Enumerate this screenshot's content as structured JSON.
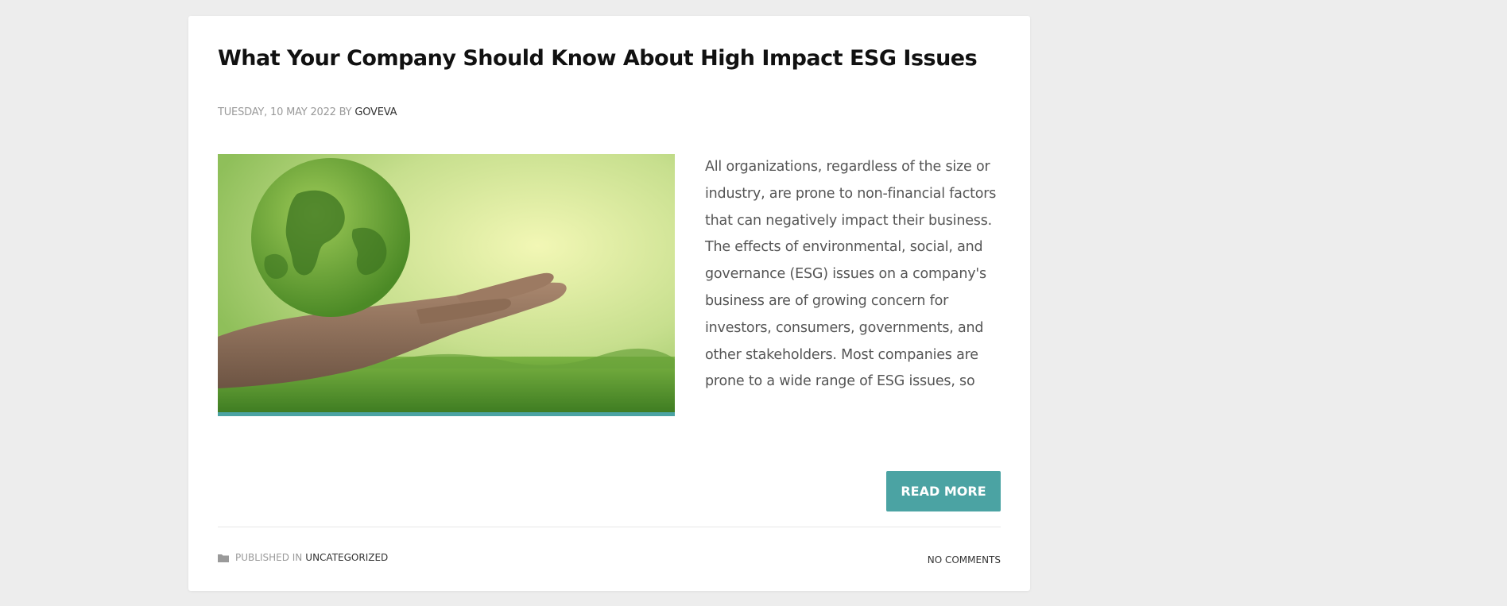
{
  "post": {
    "title": "What Your Company Should Know About High Impact ESG Issues",
    "date": "TUESDAY, 10 MAY 2022",
    "by": "BY",
    "author": "GOVEVA",
    "excerpt": "All organizations, regardless of the size or industry, are prone to non-financial factors that can negatively impact their business. The effects of environmental, social, and governance (ESG) issues on a company's business are of growing concern for investors, consumers, governments, and other stakeholders. Most companies are prone to a wide range of ESG issues, so",
    "read_more_label": "READ MORE",
    "published_in_label": "PUBLISHED IN",
    "category": "UNCATEGORIZED",
    "comments_label": "NO COMMENTS"
  },
  "colors": {
    "page_background": "#ededed",
    "card_background": "#ffffff",
    "accent": "#4ba3a3"
  },
  "icons": {
    "category": "folder-icon"
  }
}
